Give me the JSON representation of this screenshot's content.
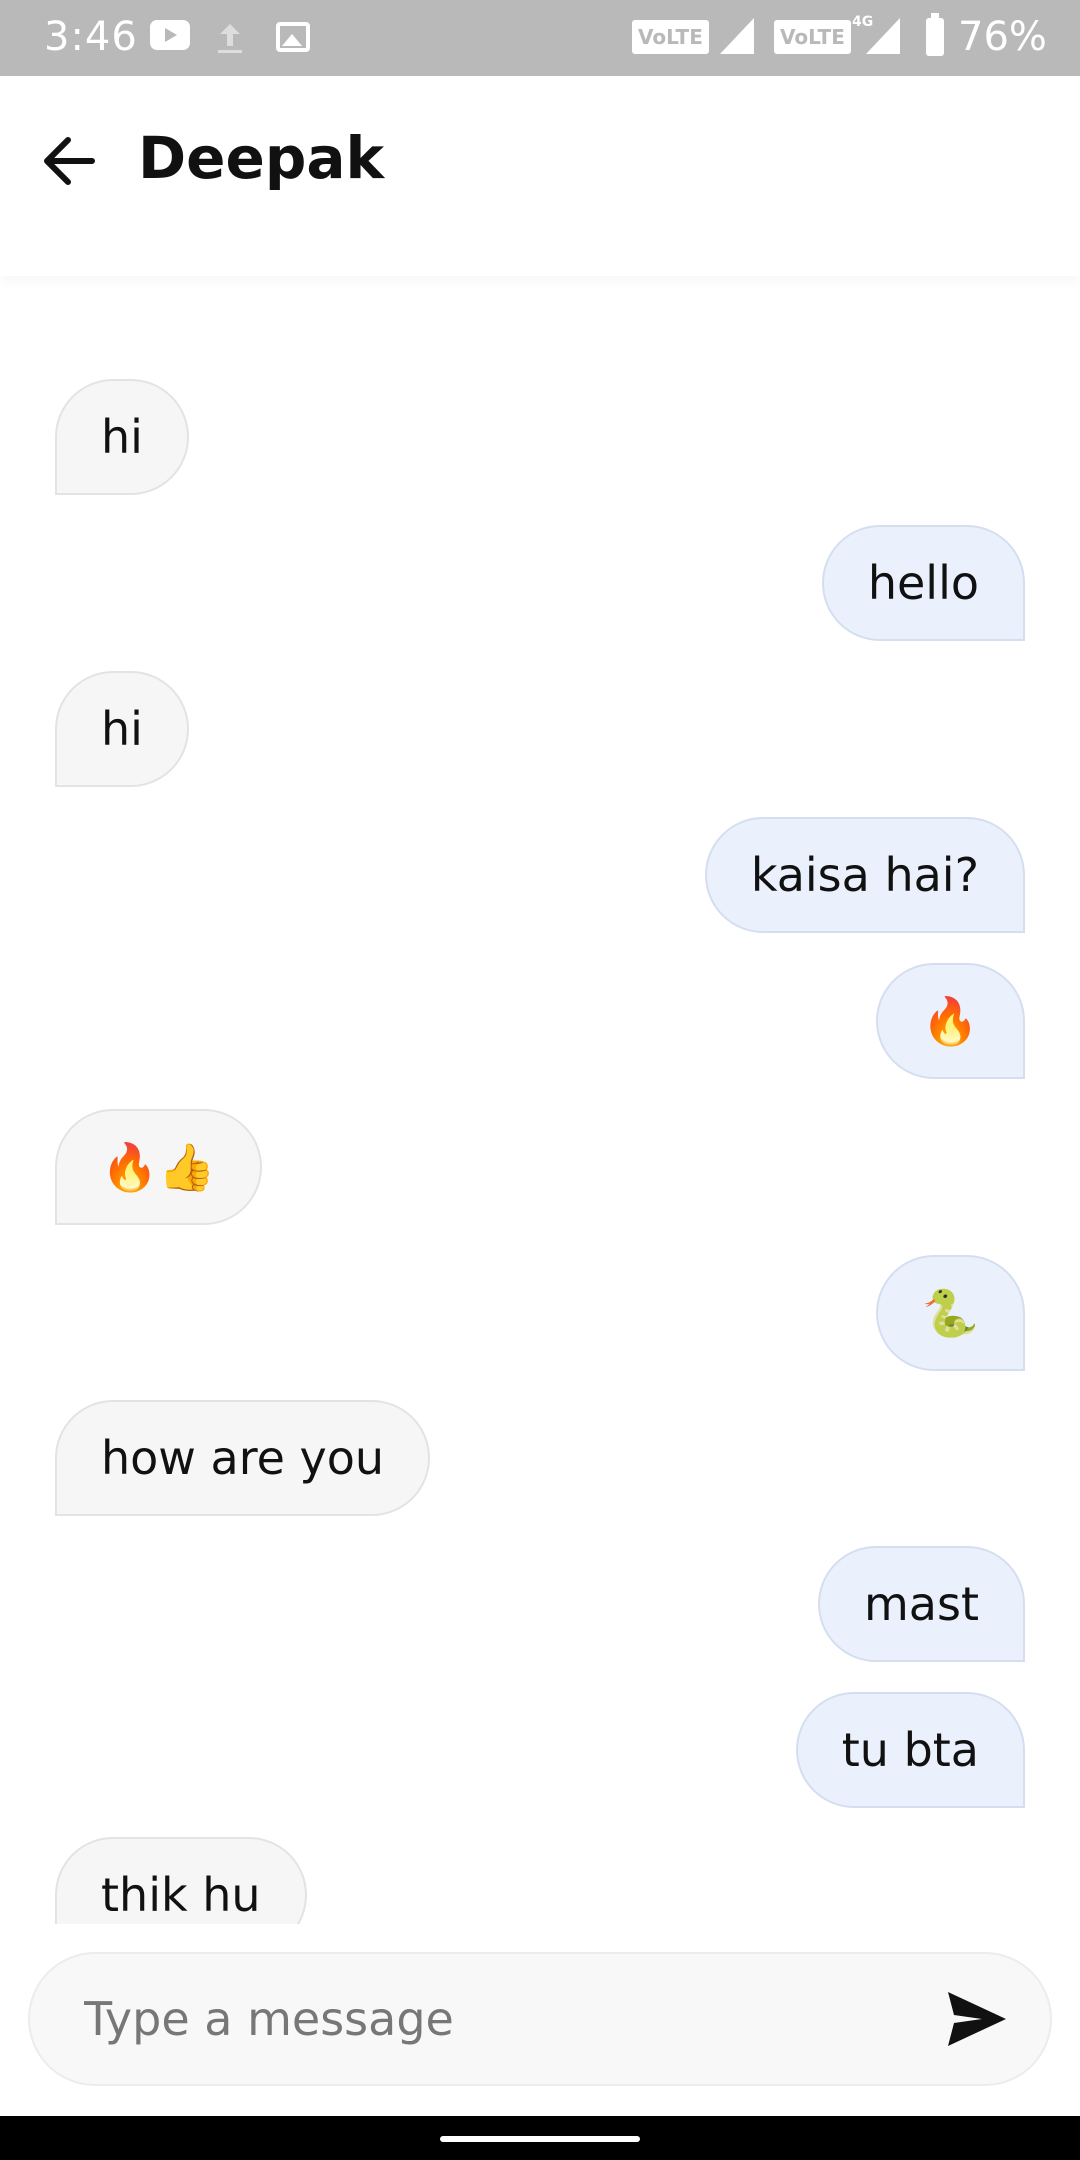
{
  "status_bar": {
    "time": "3:46",
    "volte_1": "VoLTE",
    "volte_2": "VoLTE",
    "network": "4G",
    "battery": "76%",
    "icons": [
      "youtube-icon",
      "upload-icon",
      "image-icon",
      "signal-icon",
      "battery-icon"
    ]
  },
  "header": {
    "title": "Deepak",
    "back_icon": "arrow-left-icon"
  },
  "messages": [
    {
      "side": "in",
      "text": "hi"
    },
    {
      "side": "out",
      "text": "hello"
    },
    {
      "side": "in",
      "text": "hi"
    },
    {
      "side": "out",
      "text": "kaisa hai?"
    },
    {
      "side": "out",
      "text": "🔥"
    },
    {
      "side": "in",
      "text": "🔥👍"
    },
    {
      "side": "out",
      "text": "🐍"
    },
    {
      "side": "in",
      "text": "how are you"
    },
    {
      "side": "out",
      "text": "mast"
    },
    {
      "side": "out",
      "text": "tu bta"
    },
    {
      "side": "in",
      "text": "thik hu"
    }
  ],
  "composer": {
    "placeholder": "Type a message",
    "value": "",
    "send_icon": "send-icon"
  },
  "colors": {
    "incoming_bubble": "#f6f6f6",
    "outgoing_bubble": "#eaf1fd",
    "status_bar": "#b9b9b9"
  }
}
